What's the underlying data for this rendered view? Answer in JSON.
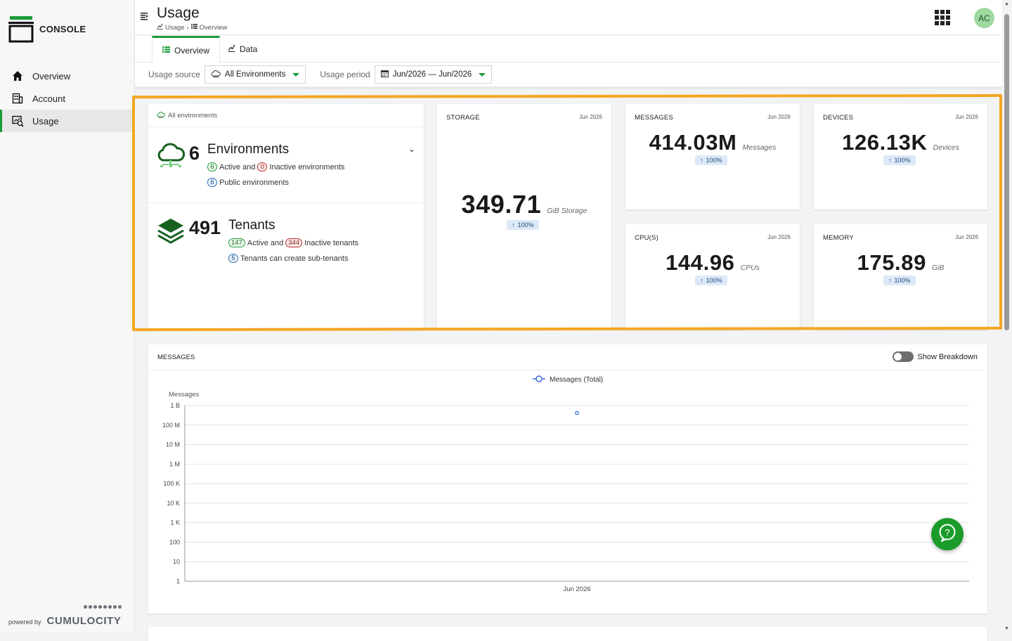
{
  "app": {
    "name": "CONSOLE",
    "powered_by": "powered by",
    "vendor": "CUMULOCITY",
    "accent": "#1a9c3a"
  },
  "sidebar": {
    "items": [
      {
        "label": "Overview",
        "icon": "home-icon"
      },
      {
        "label": "Account",
        "icon": "building-icon"
      },
      {
        "label": "Usage",
        "icon": "usage-report-icon",
        "active": true
      }
    ]
  },
  "header": {
    "title": "Usage",
    "breadcrumb": [
      "Usage",
      "Overview"
    ],
    "avatar": "AC"
  },
  "tabs": [
    {
      "label": "Overview",
      "active": true
    },
    {
      "label": "Data",
      "active": false
    }
  ],
  "filters": {
    "source_label": "Usage source",
    "source_value": "All Environments",
    "period_label": "Usage period",
    "period_value": "Jun/2026 — Jun/2026"
  },
  "environments_card": {
    "header": "All environments",
    "environments": {
      "count": "6",
      "title": "Environments",
      "active": "6",
      "active_text": "Active and",
      "inactive": "0",
      "inactive_text": "Inactive environments",
      "public": "6",
      "public_text": "Public environments"
    },
    "tenants": {
      "count": "491",
      "title": "Tenants",
      "active": "147",
      "active_text": "Active and",
      "inactive": "344",
      "inactive_text": "Inactive tenants",
      "subtenants": "5",
      "subtenants_text": "Tenants can create sub-tenants"
    }
  },
  "metrics": {
    "storage": {
      "title": "STORAGE",
      "date": "Jun 2026",
      "value": "349.71",
      "unit": "GiB Storage",
      "change": "100%"
    },
    "messages": {
      "title": "MESSAGES",
      "date": "Jun 2026",
      "value": "414.03M",
      "unit": "Messages",
      "change": "100%"
    },
    "devices": {
      "title": "DEVICES",
      "date": "Jun 2026",
      "value": "126.13K",
      "unit": "Devices",
      "change": "100%"
    },
    "cpus": {
      "title": "CPU(S)",
      "date": "Jun 2026",
      "value": "144.96",
      "unit": "CPUs",
      "change": "100%"
    },
    "memory": {
      "title": "MEMORY",
      "date": "Jun 2026",
      "value": "175.89",
      "unit": "GiB",
      "change": "100%"
    }
  },
  "messages_chart_card": {
    "title": "MESSAGES",
    "toggle_label": "Show Breakdown",
    "toggle_on": false
  },
  "chart_data": {
    "type": "scatter",
    "title": "",
    "ylabel": "Messages",
    "xlabel": "",
    "y_scale": "log",
    "ylim": [
      1,
      1000000000
    ],
    "y_ticks": [
      "1",
      "10",
      "100",
      "1 K",
      "10 K",
      "100 K",
      "1 M",
      "10 M",
      "100 M",
      "1 B"
    ],
    "x": [
      "Jun 2026"
    ],
    "series": [
      {
        "name": "Messages (Total)",
        "color": "#3b6fd6",
        "values": [
          414030000
        ]
      }
    ],
    "legend": "top-center",
    "grid": true
  }
}
